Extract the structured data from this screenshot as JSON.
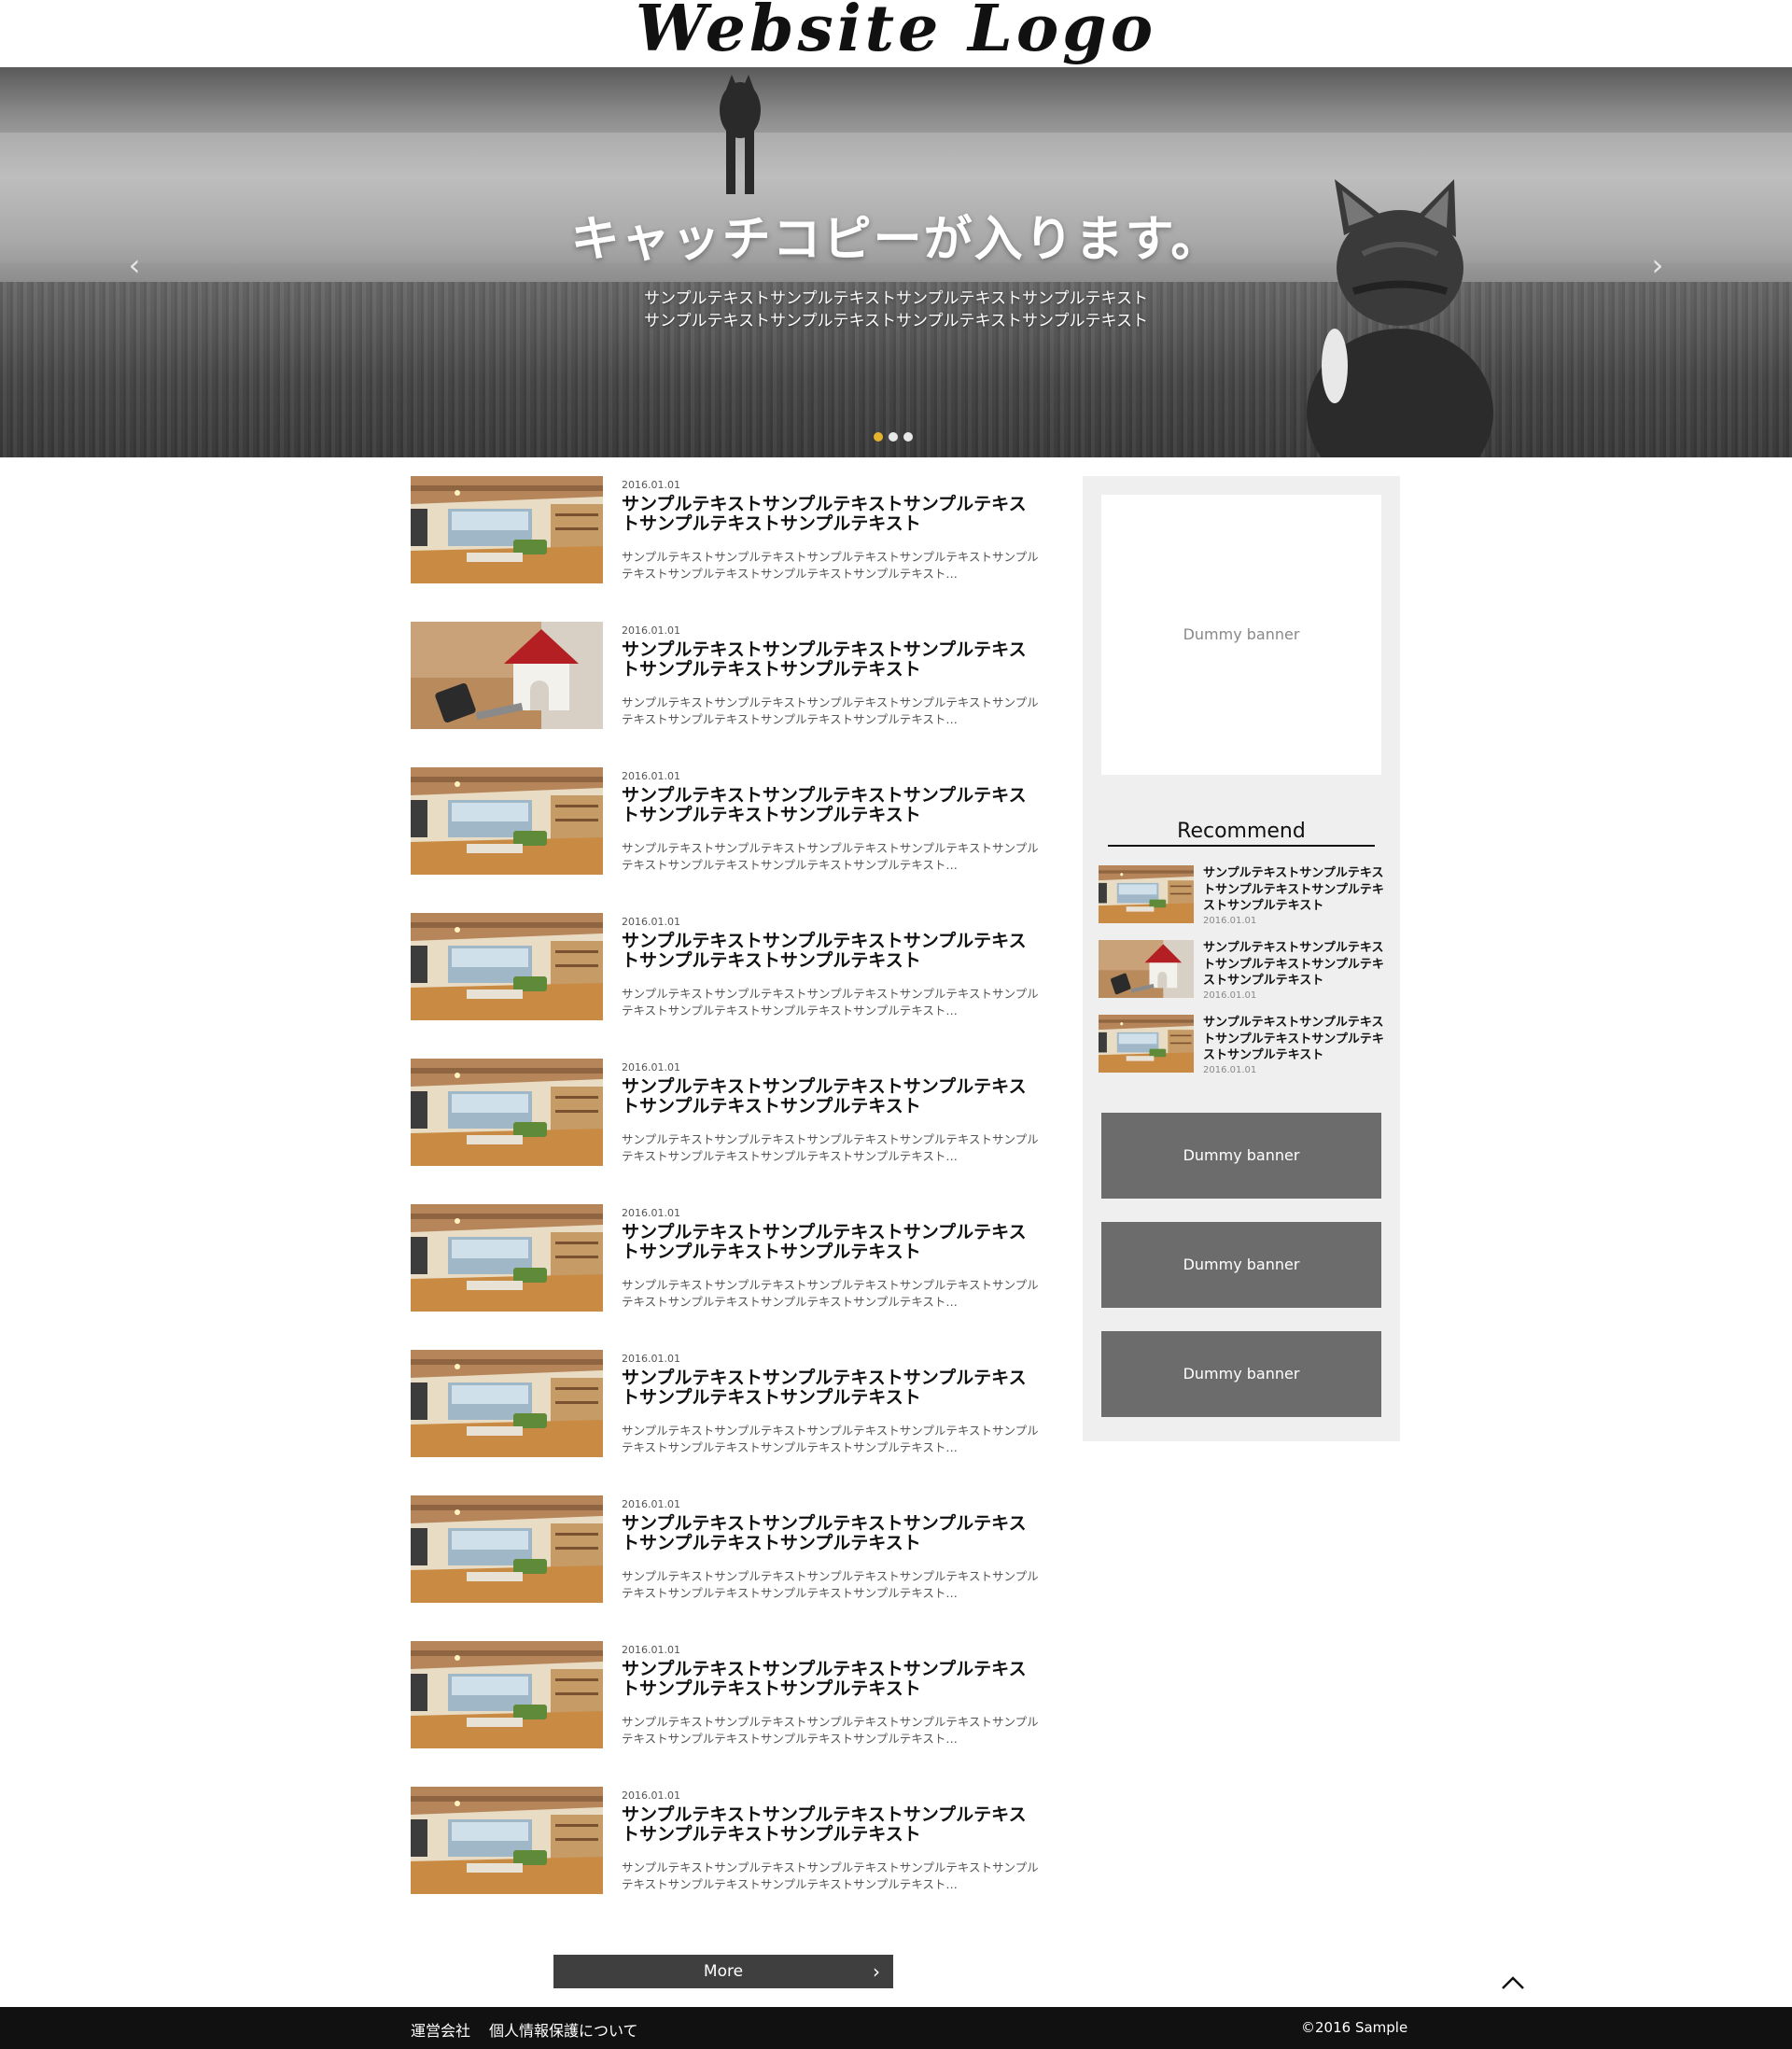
{
  "header": {
    "logo": "Website Logo"
  },
  "hero": {
    "catchcopy": "キャッチコピーが入ります。",
    "subtext": [
      "サンプルテキストサンプルテキストサンプルテキストサンプルテキスト",
      "サンプルテキストサンプルテキストサンプルテキストサンプルテキスト"
    ],
    "prev_icon": "chevron-left-icon",
    "next_icon": "chevron-right-icon",
    "slides_count": 3,
    "active_slide": 1,
    "dot_active_color": "#e6b32e"
  },
  "articles": [
    {
      "date": "2016.01.01",
      "title": "サンプルテキストサンプルテキストサンプルテキストサンプルテキストサンプルテキスト",
      "excerpt": "サンプルテキストサンプルテキストサンプルテキストサンプルテキストサンプルテキストサンプルテキストサンプルテキストサンプルテキスト…",
      "image": "interior"
    },
    {
      "date": "2016.01.01",
      "title": "サンプルテキストサンプルテキストサンプルテキストサンプルテキストサンプルテキスト",
      "excerpt": "サンプルテキストサンプルテキストサンプルテキストサンプルテキストサンプルテキストサンプルテキストサンプルテキストサンプルテキスト…",
      "image": "house"
    },
    {
      "date": "2016.01.01",
      "title": "サンプルテキストサンプルテキストサンプルテキストサンプルテキストサンプルテキスト",
      "excerpt": "サンプルテキストサンプルテキストサンプルテキストサンプルテキストサンプルテキストサンプルテキストサンプルテキストサンプルテキスト…",
      "image": "interior"
    },
    {
      "date": "2016.01.01",
      "title": "サンプルテキストサンプルテキストサンプルテキストサンプルテキストサンプルテキスト",
      "excerpt": "サンプルテキストサンプルテキストサンプルテキストサンプルテキストサンプルテキストサンプルテキストサンプルテキストサンプルテキスト…",
      "image": "interior"
    },
    {
      "date": "2016.01.01",
      "title": "サンプルテキストサンプルテキストサンプルテキストサンプルテキストサンプルテキスト",
      "excerpt": "サンプルテキストサンプルテキストサンプルテキストサンプルテキストサンプルテキストサンプルテキストサンプルテキストサンプルテキスト…",
      "image": "interior"
    },
    {
      "date": "2016.01.01",
      "title": "サンプルテキストサンプルテキストサンプルテキストサンプルテキストサンプルテキスト",
      "excerpt": "サンプルテキストサンプルテキストサンプルテキストサンプルテキストサンプルテキストサンプルテキストサンプルテキストサンプルテキスト…",
      "image": "interior"
    },
    {
      "date": "2016.01.01",
      "title": "サンプルテキストサンプルテキストサンプルテキストサンプルテキストサンプルテキスト",
      "excerpt": "サンプルテキストサンプルテキストサンプルテキストサンプルテキストサンプルテキストサンプルテキストサンプルテキストサンプルテキスト…",
      "image": "interior"
    },
    {
      "date": "2016.01.01",
      "title": "サンプルテキストサンプルテキストサンプルテキストサンプルテキストサンプルテキスト",
      "excerpt": "サンプルテキストサンプルテキストサンプルテキストサンプルテキストサンプルテキストサンプルテキストサンプルテキストサンプルテキスト…",
      "image": "interior"
    },
    {
      "date": "2016.01.01",
      "title": "サンプルテキストサンプルテキストサンプルテキストサンプルテキストサンプルテキスト",
      "excerpt": "サンプルテキストサンプルテキストサンプルテキストサンプルテキストサンプルテキストサンプルテキストサンプルテキストサンプルテキスト…",
      "image": "interior"
    },
    {
      "date": "2016.01.01",
      "title": "サンプルテキストサンプルテキストサンプルテキストサンプルテキストサンプルテキスト",
      "excerpt": "サンプルテキストサンプルテキストサンプルテキストサンプルテキストサンプルテキストサンプルテキストサンプルテキストサンプルテキスト…",
      "image": "interior"
    }
  ],
  "sidebar": {
    "banner_top": "Dummy banner",
    "recommend_title": "Recommend",
    "recommend": [
      {
        "text": "サンプルテキストサンプルテキストサンプルテキストサンプルテキストサンプルテキスト",
        "date": "2016.01.01",
        "image": "interior"
      },
      {
        "text": "サンプルテキストサンプルテキストサンプルテキストサンプルテキストサンプルテキスト",
        "date": "2016.01.01",
        "image": "house"
      },
      {
        "text": "サンプルテキストサンプルテキストサンプルテキストサンプルテキストサンプルテキスト",
        "date": "2016.01.01",
        "image": "interior"
      }
    ],
    "banners": [
      "Dummy banner",
      "Dummy banner",
      "Dummy banner"
    ]
  },
  "more": {
    "label": "More",
    "icon": "chevron-right-icon"
  },
  "to_top": {
    "icon": "chevron-up-icon"
  },
  "footer": {
    "links": [
      "運営会社",
      "個人情報保護について"
    ],
    "copyright": "©2016 Sample"
  }
}
